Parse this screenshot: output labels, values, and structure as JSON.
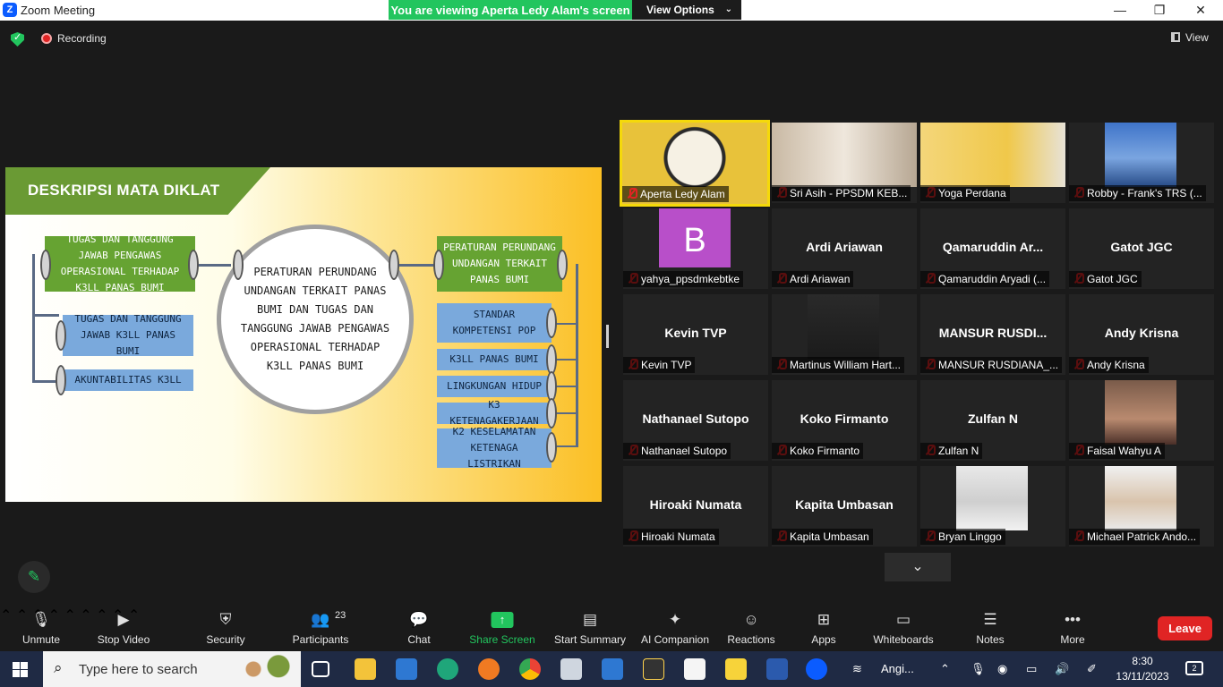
{
  "window": {
    "title": "Zoom Meeting",
    "min_glyph": "—",
    "max_glyph": "❐",
    "close_glyph": "✕",
    "logo": "Z"
  },
  "viewing_banner": {
    "text": "You are viewing Aperta Ledy Alam's screen",
    "options_label": "View Options",
    "chevron": "⌄"
  },
  "status": {
    "recording": "Recording",
    "view_label": "View"
  },
  "slide": {
    "heading": "DESKRIPSI MATA DIKLAT",
    "left_top": "TUGAS DAN TANGGUNG JAWAB PENGAWAS OPERASIONAL TERHADAP K3LL PANAS BUMI",
    "left_mid": "TUGAS DAN TANGGUNG JAWAB K3LL PANAS BUMI",
    "left_bot": "AKUNTABILITAS K3LL",
    "center": "PERATURAN PERUNDANG UNDANGAN TERKAIT PANAS BUMI DAN TUGAS DAN TANGGUNG JAWAB PENGAWAS OPERASIONAL TERHADAP K3LL PANAS BUMI",
    "right_top": "PERATURAN PERUNDANG UNDANGAN TERKAIT PANAS BUMI",
    "right_items": [
      "STANDAR KOMPETENSI POP",
      "K3LL PANAS BUMI",
      "LINGKUNGAN HIDUP",
      "K3 KETENAGAKERJAAN",
      "K2 KESELAMATAN KETENAGA LISTRIKAN"
    ]
  },
  "participants_grid": [
    {
      "display": "",
      "label": "Aperta Ledy Alam"
    },
    {
      "display": "",
      "label": "Sri Asih - PPSDM KEB..."
    },
    {
      "display": "",
      "label": "Yoga Perdana"
    },
    {
      "display": "",
      "label": "Robby - Frank's TRS (..."
    },
    {
      "display": "B",
      "label": "yahya_ppsdmkebtke"
    },
    {
      "display": "Ardi Ariawan",
      "label": "Ardi Ariawan"
    },
    {
      "display": "Qamaruddin  Ar...",
      "label": "Qamaruddin Aryadi (..."
    },
    {
      "display": "Gatot JGC",
      "label": "Gatot JGC"
    },
    {
      "display": "Kevin TVP",
      "label": "Kevin TVP"
    },
    {
      "display": "",
      "label": "Martinus William Hart..."
    },
    {
      "display": "MANSUR  RUSDI...",
      "label": "MANSUR RUSDIANA_..."
    },
    {
      "display": "Andy Krisna",
      "label": "Andy Krisna"
    },
    {
      "display": "Nathanael Sutopo",
      "label": "Nathanael Sutopo"
    },
    {
      "display": "Koko Firmanto",
      "label": "Koko Firmanto"
    },
    {
      "display": "Zulfan N",
      "label": "Zulfan N"
    },
    {
      "display": "",
      "label": "Faisal Wahyu A"
    },
    {
      "display": "Hiroaki Numata",
      "label": "Hiroaki Numata"
    },
    {
      "display": "Kapita Umbasan",
      "label": "Kapita Umbasan"
    },
    {
      "display": "",
      "label": "Bryan Linggo"
    },
    {
      "display": "",
      "label": "Michael Patrick Ando..."
    }
  ],
  "toolbar": {
    "unmute": "Unmute",
    "stop_video": "Stop Video",
    "security": "Security",
    "participants": "Participants",
    "participants_count": "23",
    "chat": "Chat",
    "share_screen": "Share Screen",
    "start_summary": "Start Summary",
    "ai_companion": "AI Companion",
    "reactions": "Reactions",
    "apps": "Apps",
    "whiteboards": "Whiteboards",
    "notes": "Notes",
    "more": "More",
    "leave": "Leave"
  },
  "taskbar": {
    "search_placeholder": "Type here to search",
    "weather": "Angi...",
    "time": "8:30",
    "date": "13/11/2023",
    "notifications": "2"
  },
  "colors": {
    "accent_green": "#22c55e",
    "leave_red": "#e02424",
    "active_speaker": "#f5d90a"
  }
}
